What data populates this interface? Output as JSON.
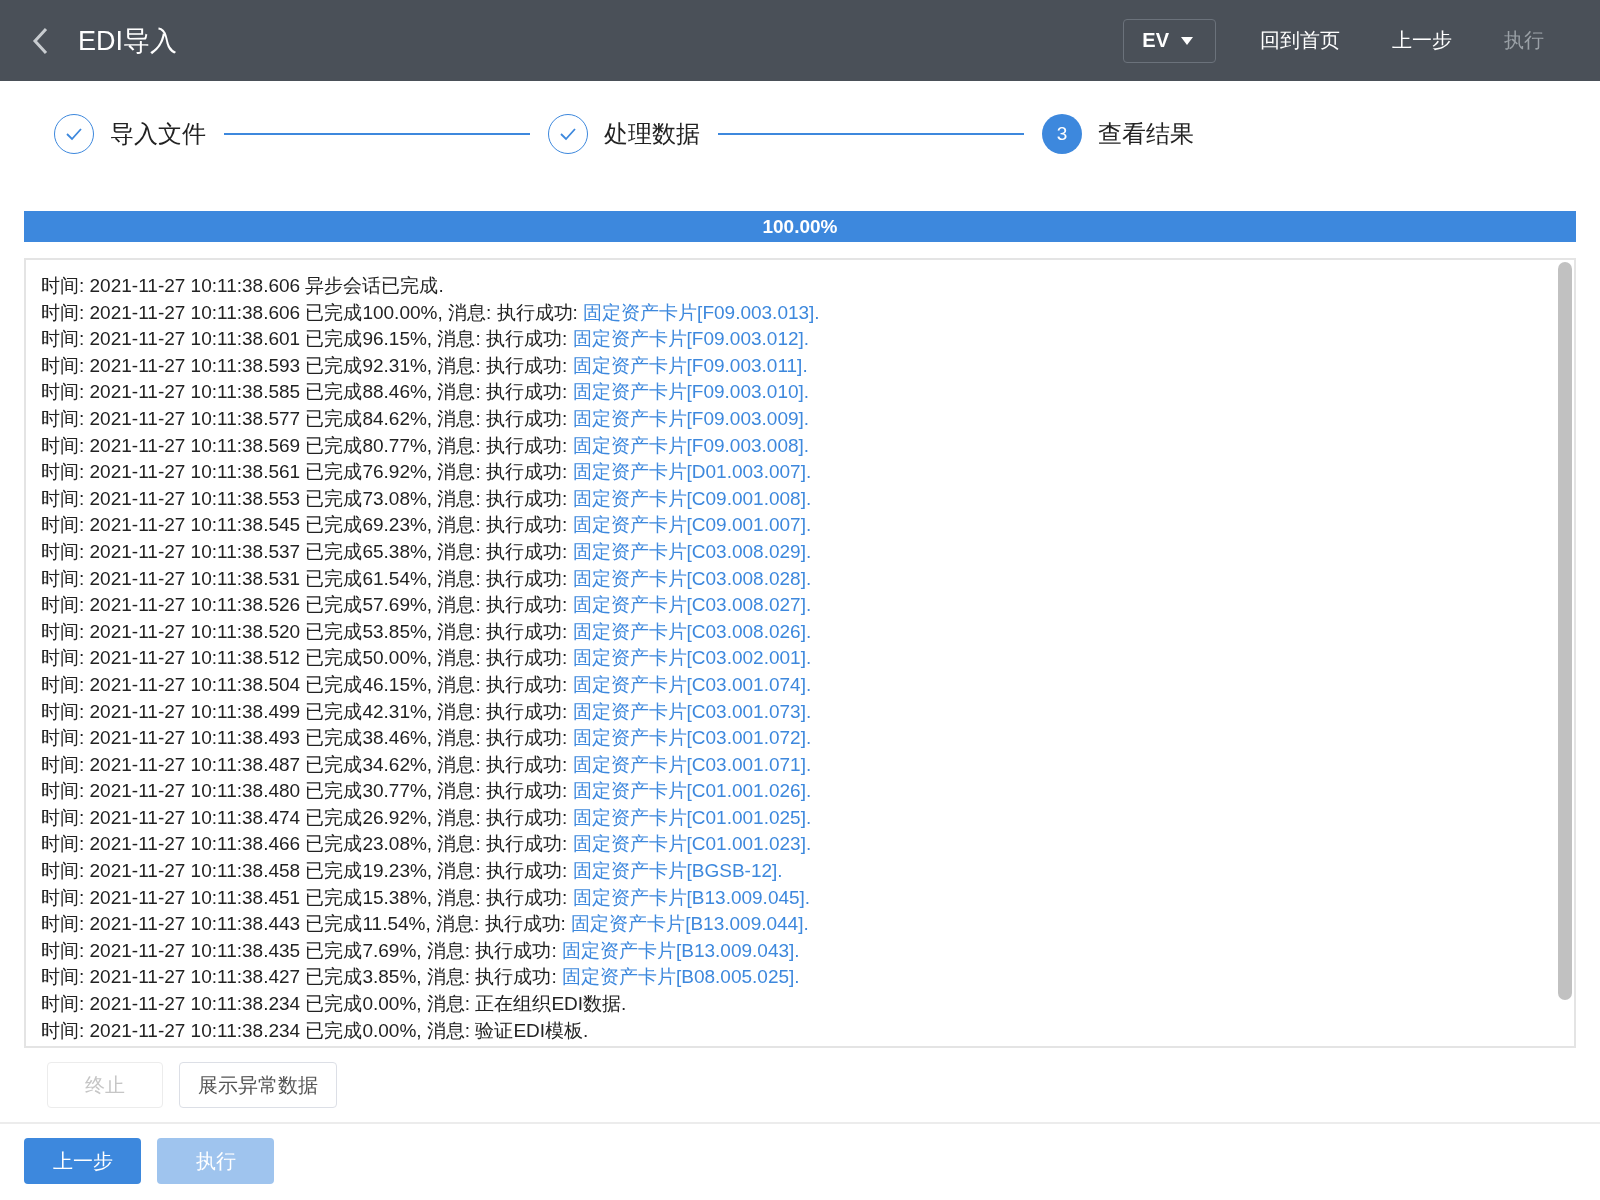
{
  "header": {
    "title": "EDI导入",
    "dropdown": "EV",
    "actions": [
      {
        "label": "回到首页",
        "disabled": false
      },
      {
        "label": "上一步",
        "disabled": false
      },
      {
        "label": "执行",
        "disabled": true
      }
    ]
  },
  "steps": [
    {
      "label": "导入文件",
      "done": true
    },
    {
      "label": "处理数据",
      "done": true
    },
    {
      "label": "查看结果",
      "number": "3",
      "done": false
    }
  ],
  "progress": {
    "level": 1,
    "label": "100.00%"
  },
  "log": [
    {
      "text": "时间: 2021-11-27 10:11:38.606 异步会话已完成."
    },
    {
      "text": "时间: 2021-11-27 10:11:38.606 已完成100.00%, 消息: 执行成功: ",
      "link": "固定资产卡片[F09.003.013]."
    },
    {
      "text": "时间: 2021-11-27 10:11:38.601 已完成96.15%, 消息: 执行成功: ",
      "link": "固定资产卡片[F09.003.012]."
    },
    {
      "text": "时间: 2021-11-27 10:11:38.593 已完成92.31%, 消息: 执行成功: ",
      "link": "固定资产卡片[F09.003.011]."
    },
    {
      "text": "时间: 2021-11-27 10:11:38.585 已完成88.46%, 消息: 执行成功: ",
      "link": "固定资产卡片[F09.003.010]."
    },
    {
      "text": "时间: 2021-11-27 10:11:38.577 已完成84.62%, 消息: 执行成功: ",
      "link": "固定资产卡片[F09.003.009]."
    },
    {
      "text": "时间: 2021-11-27 10:11:38.569 已完成80.77%, 消息: 执行成功: ",
      "link": "固定资产卡片[F09.003.008]."
    },
    {
      "text": "时间: 2021-11-27 10:11:38.561 已完成76.92%, 消息: 执行成功: ",
      "link": "固定资产卡片[D01.003.007]."
    },
    {
      "text": "时间: 2021-11-27 10:11:38.553 已完成73.08%, 消息: 执行成功: ",
      "link": "固定资产卡片[C09.001.008]."
    },
    {
      "text": "时间: 2021-11-27 10:11:38.545 已完成69.23%, 消息: 执行成功: ",
      "link": "固定资产卡片[C09.001.007]."
    },
    {
      "text": "时间: 2021-11-27 10:11:38.537 已完成65.38%, 消息: 执行成功: ",
      "link": "固定资产卡片[C03.008.029]."
    },
    {
      "text": "时间: 2021-11-27 10:11:38.531 已完成61.54%, 消息: 执行成功: ",
      "link": "固定资产卡片[C03.008.028]."
    },
    {
      "text": "时间: 2021-11-27 10:11:38.526 已完成57.69%, 消息: 执行成功: ",
      "link": "固定资产卡片[C03.008.027]."
    },
    {
      "text": "时间: 2021-11-27 10:11:38.520 已完成53.85%, 消息: 执行成功: ",
      "link": "固定资产卡片[C03.008.026]."
    },
    {
      "text": "时间: 2021-11-27 10:11:38.512 已完成50.00%, 消息: 执行成功: ",
      "link": "固定资产卡片[C03.002.001]."
    },
    {
      "text": "时间: 2021-11-27 10:11:38.504 已完成46.15%, 消息: 执行成功: ",
      "link": "固定资产卡片[C03.001.074]."
    },
    {
      "text": "时间: 2021-11-27 10:11:38.499 已完成42.31%, 消息: 执行成功: ",
      "link": "固定资产卡片[C03.001.073]."
    },
    {
      "text": "时间: 2021-11-27 10:11:38.493 已完成38.46%, 消息: 执行成功: ",
      "link": "固定资产卡片[C03.001.072]."
    },
    {
      "text": "时间: 2021-11-27 10:11:38.487 已完成34.62%, 消息: 执行成功: ",
      "link": "固定资产卡片[C03.001.071]."
    },
    {
      "text": "时间: 2021-11-27 10:11:38.480 已完成30.77%, 消息: 执行成功: ",
      "link": "固定资产卡片[C01.001.026]."
    },
    {
      "text": "时间: 2021-11-27 10:11:38.474 已完成26.92%, 消息: 执行成功: ",
      "link": "固定资产卡片[C01.001.025]."
    },
    {
      "text": "时间: 2021-11-27 10:11:38.466 已完成23.08%, 消息: 执行成功: ",
      "link": "固定资产卡片[C01.001.023]."
    },
    {
      "text": "时间: 2021-11-27 10:11:38.458 已完成19.23%, 消息: 执行成功: ",
      "link": "固定资产卡片[BGSB-12]."
    },
    {
      "text": "时间: 2021-11-27 10:11:38.451 已完成15.38%, 消息: 执行成功: ",
      "link": "固定资产卡片[B13.009.045]."
    },
    {
      "text": "时间: 2021-11-27 10:11:38.443 已完成11.54%, 消息: 执行成功: ",
      "link": "固定资产卡片[B13.009.044]."
    },
    {
      "text": "时间: 2021-11-27 10:11:38.435 已完成7.69%, 消息: 执行成功: ",
      "link": "固定资产卡片[B13.009.043]."
    },
    {
      "text": "时间: 2021-11-27 10:11:38.427 已完成3.85%, 消息: 执行成功: ",
      "link": "固定资产卡片[B08.005.025]."
    },
    {
      "text": "时间: 2021-11-27 10:11:38.234 已完成0.00%, 消息: 正在组织EDI数据."
    },
    {
      "text": "时间: 2021-11-27 10:11:38.234 已完成0.00%, 消息: 验证EDI模板."
    }
  ],
  "log_actions": [
    {
      "label": "终止",
      "disabled": true
    },
    {
      "label": "展示异常数据",
      "disabled": false
    }
  ],
  "footer": [
    {
      "label": "上一步",
      "disabled": false
    },
    {
      "label": "执行",
      "disabled": true
    }
  ]
}
